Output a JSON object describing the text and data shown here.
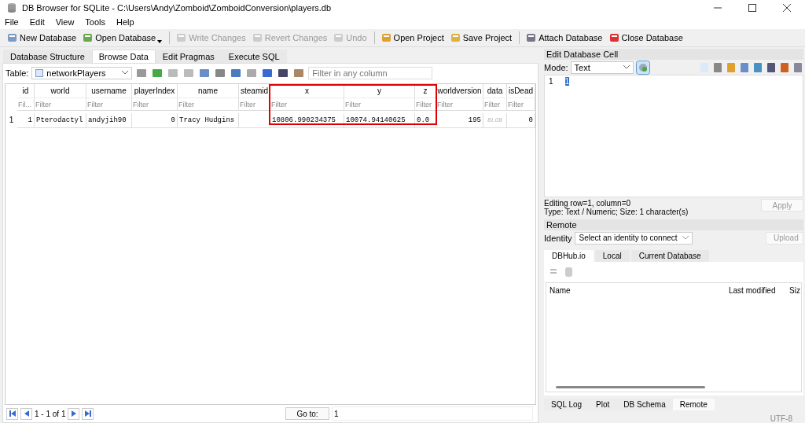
{
  "window": {
    "title": "DB Browser for SQLite - C:\\Users\\Andy\\Zomboid\\ZomboidConversion\\players.db"
  },
  "menu": [
    "File",
    "Edit",
    "View",
    "Tools",
    "Help"
  ],
  "toolbar": [
    {
      "label": "New Database",
      "disabled": false,
      "dropdown": false,
      "separator_before": false
    },
    {
      "label": "Open Database",
      "disabled": false,
      "dropdown": true,
      "separator_before": false
    },
    {
      "label": "Write Changes",
      "disabled": true,
      "dropdown": false,
      "separator_before": true
    },
    {
      "label": "Revert Changes",
      "disabled": true,
      "dropdown": false,
      "separator_before": false
    },
    {
      "label": "Undo",
      "disabled": true,
      "dropdown": false,
      "separator_before": false
    },
    {
      "label": "Open Project",
      "disabled": false,
      "dropdown": false,
      "separator_before": true
    },
    {
      "label": "Save Project",
      "disabled": false,
      "dropdown": false,
      "separator_before": false
    },
    {
      "label": "Attach Database",
      "disabled": false,
      "dropdown": false,
      "separator_before": true
    },
    {
      "label": "Close Database",
      "disabled": false,
      "dropdown": false,
      "separator_before": false
    }
  ],
  "tabs": [
    {
      "label": "Database Structure",
      "selected": false
    },
    {
      "label": "Browse Data",
      "selected": true
    },
    {
      "label": "Edit Pragmas",
      "selected": false
    },
    {
      "label": "Execute SQL",
      "selected": false
    }
  ],
  "table_toolbar": {
    "label": "Table:",
    "table": "networkPlayers",
    "filter": {
      "placeholder": "Filter in any column"
    }
  },
  "grid": {
    "columns": [
      {
        "name": "id",
        "placeholder": "Fil...",
        "highlighted": false
      },
      {
        "name": "world",
        "placeholder": "Filter",
        "highlighted": false
      },
      {
        "name": "username",
        "placeholder": "Filter",
        "highlighted": false
      },
      {
        "name": "playerIndex",
        "placeholder": "Filter",
        "highlighted": false
      },
      {
        "name": "name",
        "placeholder": "Filter",
        "highlighted": false
      },
      {
        "name": "steamid",
        "placeholder": "Filter",
        "highlighted": false
      },
      {
        "name": "x",
        "placeholder": "Filter",
        "highlighted": true
      },
      {
        "name": "y",
        "placeholder": "Filter",
        "highlighted": true
      },
      {
        "name": "z",
        "placeholder": "Filter",
        "highlighted": true
      },
      {
        "name": "worldversion",
        "placeholder": "Filter",
        "highlighted": false
      },
      {
        "name": "data",
        "placeholder": "Filter",
        "highlighted": false
      },
      {
        "name": "isDead",
        "placeholder": "Filter",
        "highlighted": false
      }
    ],
    "rows": [
      {
        "number": "1",
        "cells": [
          {
            "kind": "number",
            "text": "1"
          },
          {
            "kind": "text",
            "text": "Pterodactyl"
          },
          {
            "kind": "text",
            "text": "andyjih90"
          },
          {
            "kind": "number",
            "text": "0"
          },
          {
            "kind": "text",
            "text": "Tracy Hudgins"
          },
          {
            "kind": "empty"
          },
          {
            "kind": "text",
            "text": "10806.990234375"
          },
          {
            "kind": "text",
            "text": "10074.94140625"
          },
          {
            "kind": "text",
            "text": "0.0"
          },
          {
            "kind": "number",
            "text": "195"
          },
          {
            "kind": "blob",
            "text": "BLOB"
          },
          {
            "kind": "number",
            "text": "0"
          }
        ]
      }
    ]
  },
  "pager": {
    "range": "1 - 1 of 1",
    "goto_label": "Go to:",
    "goto_value": "1"
  },
  "edit_cell": {
    "title": "Edit Database Cell",
    "mode_label": "Mode:",
    "mode": "Text",
    "lines": [
      {
        "number": "1",
        "text": "1",
        "selected": true
      }
    ],
    "status": [
      "Editing row=1, column=0",
      "Type: Text / Numeric; Size: 1 character(s)"
    ],
    "apply": {
      "label": "Apply",
      "disabled": true
    }
  },
  "remote": {
    "title": "Remote",
    "identity_label": "Identity",
    "identity": "Select an identity to connect",
    "upload": {
      "label": "Upload",
      "disabled": true
    },
    "tabs": [
      {
        "label": "DBHub.io",
        "selected": true
      },
      {
        "label": "Local",
        "selected": false
      },
      {
        "label": "Current Database",
        "selected": false
      }
    ],
    "columns": [
      "Name",
      "Last modified",
      "Siz"
    ]
  },
  "dock_tabs": [
    {
      "label": "SQL Log",
      "selected": false
    },
    {
      "label": "Plot",
      "selected": false
    },
    {
      "label": "DB Schema",
      "selected": false
    },
    {
      "label": "Remote",
      "selected": true
    }
  ],
  "status_bar": {
    "encoding": "UTF-8"
  }
}
